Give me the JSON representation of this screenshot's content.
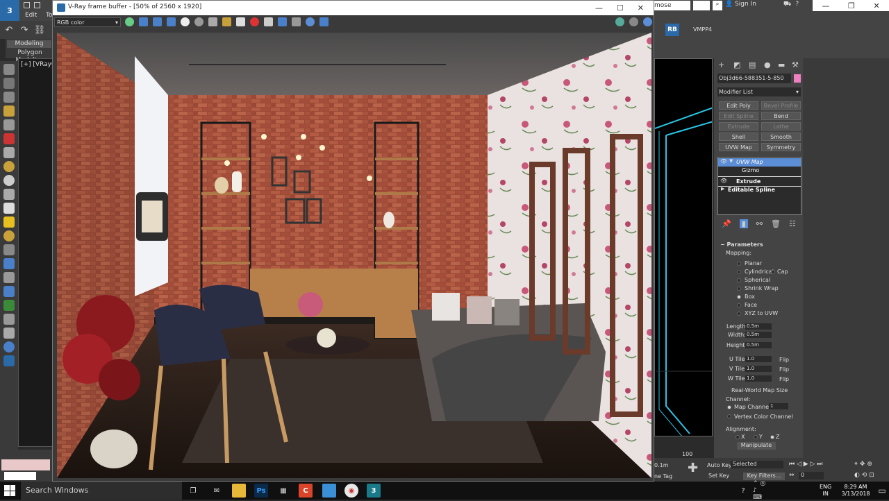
{
  "max": {
    "logo": "3",
    "menu": [
      "Edit",
      "To"
    ],
    "ribbon_tabs": [
      "Modeling",
      "Polygon Modeling"
    ],
    "viewport_left_label": "[+] [VRayCa",
    "search_text": "mose",
    "sign_in": "Sign In",
    "rb_badge": "RB",
    "vmpp": "VMPP4"
  },
  "vfb": {
    "title": "V-Ray frame buffer - [50% of 2560 x 1920]",
    "channel": "RGB color"
  },
  "command_panel": {
    "object_name": "Obj3d66-588351-5-850",
    "modifier_list": "Modifier List",
    "modifier_buttons": [
      {
        "label": "Edit Poly",
        "dim": false
      },
      {
        "label": "Bevel Profile",
        "dim": true
      },
      {
        "label": "Edit Spline",
        "dim": true
      },
      {
        "label": "Bend",
        "dim": false
      },
      {
        "label": "Extrude",
        "dim": true
      },
      {
        "label": "Lathe",
        "dim": true
      },
      {
        "label": "Shell",
        "dim": false
      },
      {
        "label": "Smooth",
        "dim": false
      },
      {
        "label": "UVW Map",
        "dim": false
      },
      {
        "label": "Symmetry",
        "dim": false
      }
    ],
    "stack": [
      "UVW Map",
      "Gizmo",
      "Extrude",
      "Editable Spline"
    ],
    "parameters_header": "Parameters",
    "mapping_label": "Mapping:",
    "mapping_options": [
      "Planar",
      "Cylindrical",
      "Cap",
      "Spherical",
      "Shrink Wrap",
      "Box",
      "Face",
      "XYZ to UVW"
    ],
    "mapping_selected": "Box",
    "length_label": "Length:",
    "length_value": "0.5m",
    "width_label": "Width:",
    "width_value": "0.5m",
    "height_label": "Height:",
    "height_value": "0.5m",
    "utile_label": "U Tile:",
    "utile_value": "1.0",
    "vtile_label": "V Tile:",
    "vtile_value": "1.0",
    "wtile_label": "W Tile:",
    "wtile_value": "1.0",
    "flip": "Flip",
    "real_world": "Real-World Map Size",
    "channel_label": "Channel:",
    "map_channel_label": "Map Channel:",
    "map_channel_value": "1",
    "vertex_color": "Vertex Color Channel",
    "alignment_label": "Alignment:",
    "align_x": "X",
    "align_y": "Y",
    "align_z": "Z",
    "manipulate": "Manipulate"
  },
  "bottom_bar": {
    "coord": "0.1m",
    "ruler": "100",
    "auto_key": "Auto Key",
    "selected": "Selected",
    "set_key": "Set Key",
    "key_filters": "Key Filters...",
    "time_tag": "ne Tag",
    "frame": "0"
  },
  "taskbar": {
    "search": "Search Windows",
    "lang_top": "ENG",
    "lang_bottom": "IN",
    "time": "8:29 AM",
    "date": "3/13/2018"
  }
}
